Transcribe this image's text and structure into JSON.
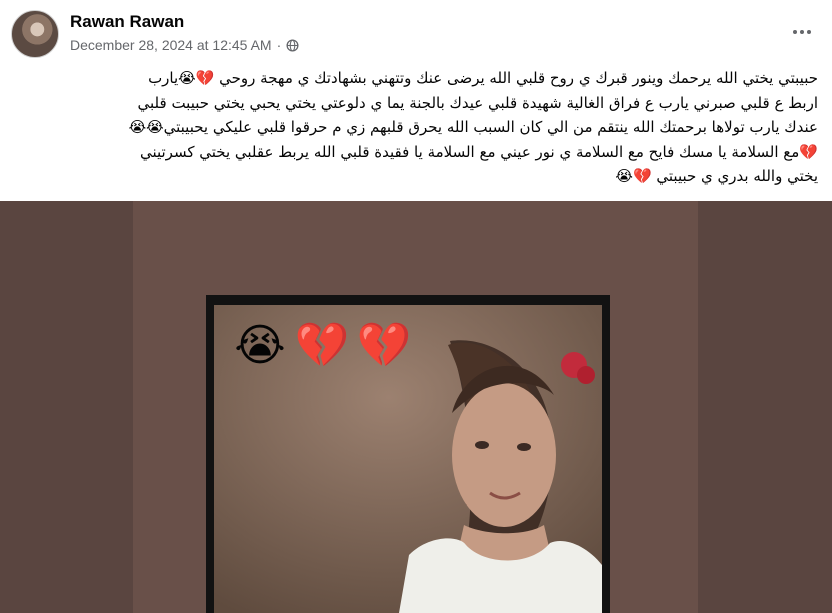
{
  "post": {
    "author": "Rawan Rawan",
    "timestamp": "December 28, 2024 at 12:45 AM",
    "separator": "·",
    "audience_icon": "globe-icon",
    "more_icon": "more-options-icon",
    "text_lines": [
      "حبيبتي يختي الله يرحمك وينور قبرك ي روح قلبي الله يرضى عنك وتتهني بشهادتك ي مهجة روحي 💔😭يارب",
      "اربط ع قلبي صبرني يارب ع فراق الغالية شهيدة قلبي عيدك بالجنة يما ي دلوعتي يختي يحبي يختي حبيبت قلبي",
      "عندك يارب تولاها برحمتك الله ينتقم من الي كان السبب الله يحرق قلبهم زي م حرقوا قلبي عليكي يحبيبتي😭😭",
      "💔مع السلامة يا مسك فايح مع السلامة ي نور عيني مع السلامة يا فقيدة قلبي الله يربط عقلبي يختي كسرتيني",
      "يختي والله بدري ي حبيبتي 💔😭"
    ]
  },
  "media": {
    "overlay_emojis": [
      "😭",
      "💔",
      "💔"
    ],
    "colors": {
      "backdrop": "#5a4540",
      "frame": "#121212"
    }
  }
}
